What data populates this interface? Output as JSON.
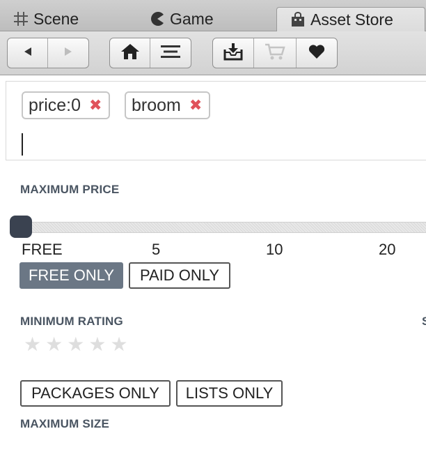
{
  "tabs": [
    {
      "label": "Scene",
      "icon": "grid-icon"
    },
    {
      "label": "Game",
      "icon": "pacman-icon"
    },
    {
      "label": "Asset Store",
      "icon": "shopping-bag-icon",
      "active": true
    }
  ],
  "toolbar": {
    "nav_group": [
      "back-icon",
      "forward-icon"
    ],
    "home_group": [
      "home-icon",
      "menu-icon"
    ],
    "store_group": [
      "downloads-icon",
      "cart-icon",
      "heart-icon"
    ]
  },
  "search": {
    "chips": [
      {
        "label": "price:0",
        "remove": "✖"
      },
      {
        "label": "broom",
        "remove": "✖"
      }
    ]
  },
  "filters": {
    "max_price": {
      "label": "MAXIMUM PRICE",
      "value_index": 0,
      "ticks": [
        "FREE",
        "5",
        "10",
        "20"
      ]
    },
    "price_toggle": {
      "free_only": "FREE ONLY",
      "paid_only": "PAID ONLY",
      "selected": "free_only"
    },
    "min_rating": {
      "label": "MINIMUM RATING",
      "edge_char": "S",
      "stars": 5,
      "value": 0
    },
    "type_toggle": {
      "packages_only": "PACKAGES ONLY",
      "lists_only": "LISTS ONLY"
    },
    "max_size": {
      "label": "MAXIMUM SIZE"
    }
  },
  "colors": {
    "chip_remove": "#e0525a",
    "toggle_selected": "#6b7785",
    "slider_thumb": "#3a4250",
    "section_label": "#4a5562"
  }
}
